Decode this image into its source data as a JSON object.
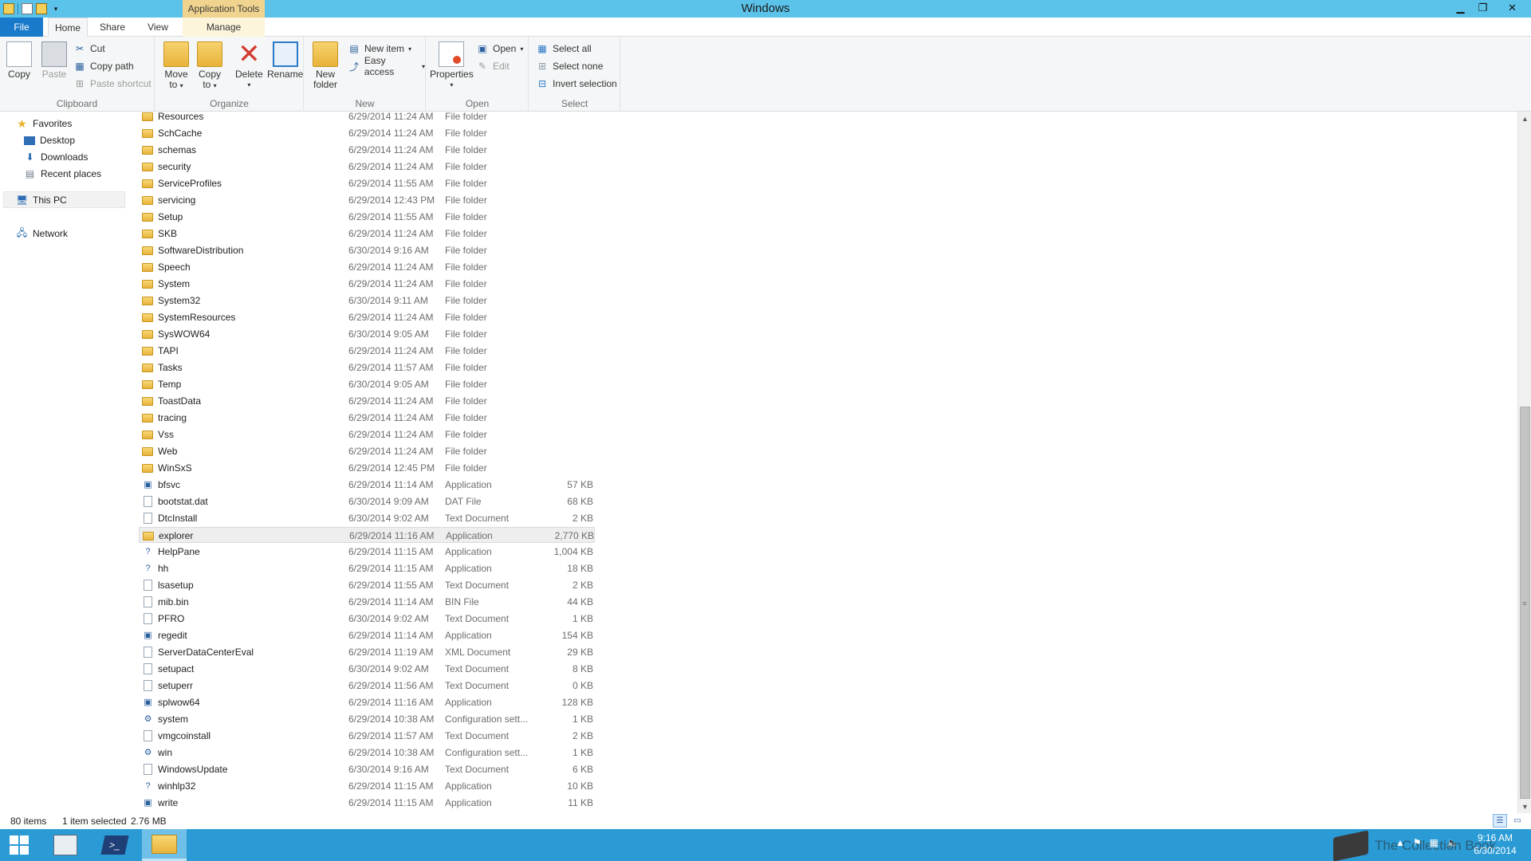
{
  "window": {
    "title": "Windows",
    "context_tab": "Application Tools",
    "min_glyph": "▁",
    "max_glyph": "❐",
    "close_glyph": "✕"
  },
  "tabs": {
    "file": "File",
    "home": "Home",
    "share": "Share",
    "view": "View",
    "manage": "Manage"
  },
  "ribbon": {
    "clipboard": {
      "label": "Clipboard",
      "copy": "Copy",
      "paste": "Paste",
      "cut": "Cut",
      "copy_path": "Copy path",
      "paste_shortcut": "Paste shortcut"
    },
    "organize": {
      "label": "Organize",
      "move_to_1": "Move",
      "move_to_2": "to",
      "copy_to_1": "Copy",
      "copy_to_2": "to",
      "delete": "Delete",
      "rename": "Rename"
    },
    "new": {
      "label": "New",
      "new_folder_1": "New",
      "new_folder_2": "folder",
      "new_item": "New item",
      "easy_access": "Easy access"
    },
    "open": {
      "label": "Open",
      "properties": "Properties",
      "open": "Open",
      "edit": "Edit"
    },
    "select": {
      "label": "Select",
      "select_all": "Select all",
      "select_none": "Select none",
      "invert_selection": "Invert selection"
    }
  },
  "nav": {
    "favorites": "Favorites",
    "desktop": "Desktop",
    "downloads": "Downloads",
    "recent_places": "Recent places",
    "this_pc": "This PC",
    "network": "Network"
  },
  "files": [
    {
      "name": "Resources",
      "date": "6/29/2014 11:24 AM",
      "type": "File folder",
      "size": "",
      "icon": "folder"
    },
    {
      "name": "SchCache",
      "date": "6/29/2014 11:24 AM",
      "type": "File folder",
      "size": "",
      "icon": "folder"
    },
    {
      "name": "schemas",
      "date": "6/29/2014 11:24 AM",
      "type": "File folder",
      "size": "",
      "icon": "folder"
    },
    {
      "name": "security",
      "date": "6/29/2014 11:24 AM",
      "type": "File folder",
      "size": "",
      "icon": "folder"
    },
    {
      "name": "ServiceProfiles",
      "date": "6/29/2014 11:55 AM",
      "type": "File folder",
      "size": "",
      "icon": "folder"
    },
    {
      "name": "servicing",
      "date": "6/29/2014 12:43 PM",
      "type": "File folder",
      "size": "",
      "icon": "folder"
    },
    {
      "name": "Setup",
      "date": "6/29/2014 11:55 AM",
      "type": "File folder",
      "size": "",
      "icon": "folder"
    },
    {
      "name": "SKB",
      "date": "6/29/2014 11:24 AM",
      "type": "File folder",
      "size": "",
      "icon": "folder"
    },
    {
      "name": "SoftwareDistribution",
      "date": "6/30/2014 9:16 AM",
      "type": "File folder",
      "size": "",
      "icon": "folder"
    },
    {
      "name": "Speech",
      "date": "6/29/2014 11:24 AM",
      "type": "File folder",
      "size": "",
      "icon": "folder"
    },
    {
      "name": "System",
      "date": "6/29/2014 11:24 AM",
      "type": "File folder",
      "size": "",
      "icon": "folder"
    },
    {
      "name": "System32",
      "date": "6/30/2014 9:11 AM",
      "type": "File folder",
      "size": "",
      "icon": "folder"
    },
    {
      "name": "SystemResources",
      "date": "6/29/2014 11:24 AM",
      "type": "File folder",
      "size": "",
      "icon": "folder"
    },
    {
      "name": "SysWOW64",
      "date": "6/30/2014 9:05 AM",
      "type": "File folder",
      "size": "",
      "icon": "folder"
    },
    {
      "name": "TAPI",
      "date": "6/29/2014 11:24 AM",
      "type": "File folder",
      "size": "",
      "icon": "folder"
    },
    {
      "name": "Tasks",
      "date": "6/29/2014 11:57 AM",
      "type": "File folder",
      "size": "",
      "icon": "folder"
    },
    {
      "name": "Temp",
      "date": "6/30/2014 9:05 AM",
      "type": "File folder",
      "size": "",
      "icon": "folder"
    },
    {
      "name": "ToastData",
      "date": "6/29/2014 11:24 AM",
      "type": "File folder",
      "size": "",
      "icon": "folder"
    },
    {
      "name": "tracing",
      "date": "6/29/2014 11:24 AM",
      "type": "File folder",
      "size": "",
      "icon": "folder"
    },
    {
      "name": "Vss",
      "date": "6/29/2014 11:24 AM",
      "type": "File folder",
      "size": "",
      "icon": "folder"
    },
    {
      "name": "Web",
      "date": "6/29/2014 11:24 AM",
      "type": "File folder",
      "size": "",
      "icon": "folder"
    },
    {
      "name": "WinSxS",
      "date": "6/29/2014 12:45 PM",
      "type": "File folder",
      "size": "",
      "icon": "folder"
    },
    {
      "name": "bfsvc",
      "date": "6/29/2014 11:14 AM",
      "type": "Application",
      "size": "57 KB",
      "icon": "app"
    },
    {
      "name": "bootstat.dat",
      "date": "6/30/2014 9:09 AM",
      "type": "DAT File",
      "size": "68 KB",
      "icon": "doc"
    },
    {
      "name": "DtcInstall",
      "date": "6/30/2014 9:02 AM",
      "type": "Text Document",
      "size": "2 KB",
      "icon": "doc"
    },
    {
      "name": "explorer",
      "date": "6/29/2014 11:16 AM",
      "type": "Application",
      "size": "2,770 KB",
      "icon": "explorer",
      "selected": true
    },
    {
      "name": "HelpPane",
      "date": "6/29/2014 11:15 AM",
      "type": "Application",
      "size": "1,004 KB",
      "icon": "help"
    },
    {
      "name": "hh",
      "date": "6/29/2014 11:15 AM",
      "type": "Application",
      "size": "18 KB",
      "icon": "help"
    },
    {
      "name": "lsasetup",
      "date": "6/29/2014 11:55 AM",
      "type": "Text Document",
      "size": "2 KB",
      "icon": "doc"
    },
    {
      "name": "mib.bin",
      "date": "6/29/2014 11:14 AM",
      "type": "BIN File",
      "size": "44 KB",
      "icon": "doc"
    },
    {
      "name": "PFRO",
      "date": "6/30/2014 9:02 AM",
      "type": "Text Document",
      "size": "1 KB",
      "icon": "doc"
    },
    {
      "name": "regedit",
      "date": "6/29/2014 11:14 AM",
      "type": "Application",
      "size": "154 KB",
      "icon": "app"
    },
    {
      "name": "ServerDataCenterEval",
      "date": "6/29/2014 11:19 AM",
      "type": "XML Document",
      "size": "29 KB",
      "icon": "doc"
    },
    {
      "name": "setupact",
      "date": "6/30/2014 9:02 AM",
      "type": "Text Document",
      "size": "8 KB",
      "icon": "doc"
    },
    {
      "name": "setuperr",
      "date": "6/29/2014 11:56 AM",
      "type": "Text Document",
      "size": "0 KB",
      "icon": "doc"
    },
    {
      "name": "splwow64",
      "date": "6/29/2014 11:16 AM",
      "type": "Application",
      "size": "128 KB",
      "icon": "app"
    },
    {
      "name": "system",
      "date": "6/29/2014 10:38 AM",
      "type": "Configuration sett...",
      "size": "1 KB",
      "icon": "config"
    },
    {
      "name": "vmgcoinstall",
      "date": "6/29/2014 11:57 AM",
      "type": "Text Document",
      "size": "2 KB",
      "icon": "doc"
    },
    {
      "name": "win",
      "date": "6/29/2014 10:38 AM",
      "type": "Configuration sett...",
      "size": "1 KB",
      "icon": "config"
    },
    {
      "name": "WindowsUpdate",
      "date": "6/30/2014 9:16 AM",
      "type": "Text Document",
      "size": "6 KB",
      "icon": "doc"
    },
    {
      "name": "winhlp32",
      "date": "6/29/2014 11:15 AM",
      "type": "Application",
      "size": "10 KB",
      "icon": "help"
    },
    {
      "name": "write",
      "date": "6/29/2014 11:15 AM",
      "type": "Application",
      "size": "11 KB",
      "icon": "app"
    }
  ],
  "status": {
    "items": "80 items",
    "selected": "1 item selected",
    "size": "2.76 MB"
  },
  "taskbar": {
    "time": "9:16 AM",
    "date": "6/30/2014",
    "watermark": "The Collection Book"
  },
  "colors": {
    "titlebar": "#5bc3ea",
    "file_tab": "#1979ca",
    "context_tab": "#f0d38e",
    "taskbar": "#2b9bd6"
  }
}
